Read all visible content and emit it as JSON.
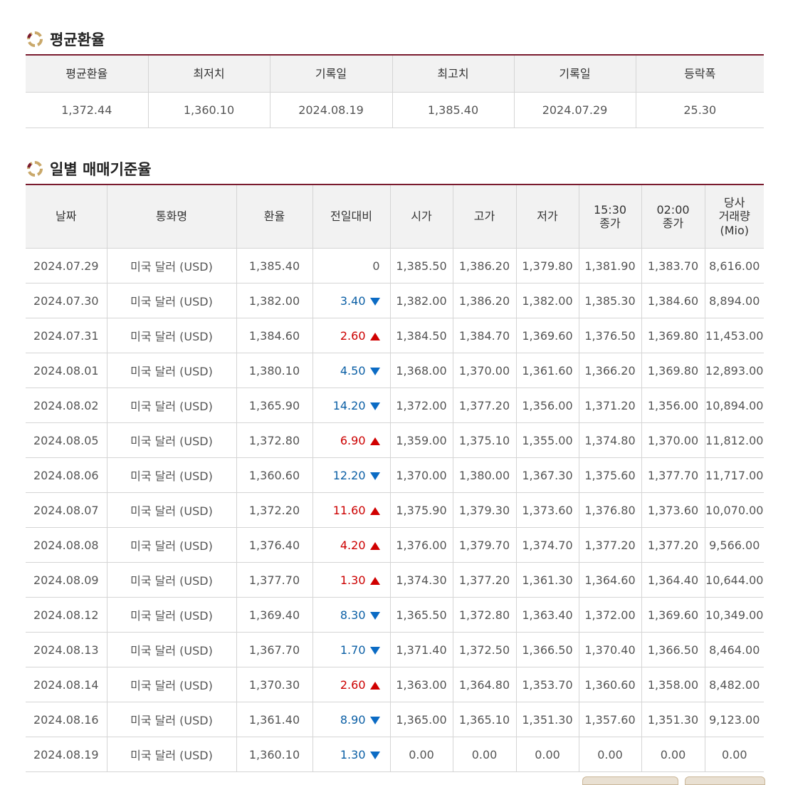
{
  "average_section": {
    "title": "평균환율",
    "headers": [
      "평균환율",
      "최저치",
      "기록일",
      "최고치",
      "기록일",
      "등락폭"
    ],
    "values": [
      "1,372.44",
      "1,360.10",
      "2024.08.19",
      "1,385.40",
      "2024.07.29",
      "25.30"
    ]
  },
  "daily_section": {
    "title": "일별 매매기준율",
    "headers": [
      "날짜",
      "통화명",
      "환율",
      "전일대비",
      "시가",
      "고가",
      "저가",
      "15:30\n종가",
      "02:00\n종가",
      "당사\n거래량\n(Mio)"
    ],
    "rows": [
      {
        "date": "2024.07.29",
        "currency": "미국 달러 (USD)",
        "rate": "1,385.40",
        "change": "0",
        "dir": "none",
        "open": "1,385.50",
        "high": "1,386.20",
        "low": "1,379.80",
        "close1530": "1,381.90",
        "close0200": "1,383.70",
        "volume": "8,616.00"
      },
      {
        "date": "2024.07.30",
        "currency": "미국 달러 (USD)",
        "rate": "1,382.00",
        "change": "3.40",
        "dir": "down",
        "open": "1,382.00",
        "high": "1,386.20",
        "low": "1,382.00",
        "close1530": "1,385.30",
        "close0200": "1,384.60",
        "volume": "8,894.00"
      },
      {
        "date": "2024.07.31",
        "currency": "미국 달러 (USD)",
        "rate": "1,384.60",
        "change": "2.60",
        "dir": "up",
        "open": "1,384.50",
        "high": "1,384.70",
        "low": "1,369.60",
        "close1530": "1,376.50",
        "close0200": "1,369.80",
        "volume": "11,453.00"
      },
      {
        "date": "2024.08.01",
        "currency": "미국 달러 (USD)",
        "rate": "1,380.10",
        "change": "4.50",
        "dir": "down",
        "open": "1,368.00",
        "high": "1,370.00",
        "low": "1,361.60",
        "close1530": "1,366.20",
        "close0200": "1,369.80",
        "volume": "12,893.00"
      },
      {
        "date": "2024.08.02",
        "currency": "미국 달러 (USD)",
        "rate": "1,365.90",
        "change": "14.20",
        "dir": "down",
        "open": "1,372.00",
        "high": "1,377.20",
        "low": "1,356.00",
        "close1530": "1,371.20",
        "close0200": "1,356.00",
        "volume": "10,894.00"
      },
      {
        "date": "2024.08.05",
        "currency": "미국 달러 (USD)",
        "rate": "1,372.80",
        "change": "6.90",
        "dir": "up",
        "open": "1,359.00",
        "high": "1,375.10",
        "low": "1,355.00",
        "close1530": "1,374.80",
        "close0200": "1,370.00",
        "volume": "11,812.00"
      },
      {
        "date": "2024.08.06",
        "currency": "미국 달러 (USD)",
        "rate": "1,360.60",
        "change": "12.20",
        "dir": "down",
        "open": "1,370.00",
        "high": "1,380.00",
        "low": "1,367.30",
        "close1530": "1,375.60",
        "close0200": "1,377.70",
        "volume": "11,717.00"
      },
      {
        "date": "2024.08.07",
        "currency": "미국 달러 (USD)",
        "rate": "1,372.20",
        "change": "11.60",
        "dir": "up",
        "open": "1,375.90",
        "high": "1,379.30",
        "low": "1,373.60",
        "close1530": "1,376.80",
        "close0200": "1,373.60",
        "volume": "10,070.00"
      },
      {
        "date": "2024.08.08",
        "currency": "미국 달러 (USD)",
        "rate": "1,376.40",
        "change": "4.20",
        "dir": "up",
        "open": "1,376.00",
        "high": "1,379.70",
        "low": "1,374.70",
        "close1530": "1,377.20",
        "close0200": "1,377.20",
        "volume": "9,566.00"
      },
      {
        "date": "2024.08.09",
        "currency": "미국 달러 (USD)",
        "rate": "1,377.70",
        "change": "1.30",
        "dir": "up",
        "open": "1,374.30",
        "high": "1,377.20",
        "low": "1,361.30",
        "close1530": "1,364.60",
        "close0200": "1,364.40",
        "volume": "10,644.00"
      },
      {
        "date": "2024.08.12",
        "currency": "미국 달러 (USD)",
        "rate": "1,369.40",
        "change": "8.30",
        "dir": "down",
        "open": "1,365.50",
        "high": "1,372.80",
        "low": "1,363.40",
        "close1530": "1,372.00",
        "close0200": "1,369.60",
        "volume": "10,349.00"
      },
      {
        "date": "2024.08.13",
        "currency": "미국 달러 (USD)",
        "rate": "1,367.70",
        "change": "1.70",
        "dir": "down",
        "open": "1,371.40",
        "high": "1,372.50",
        "low": "1,366.50",
        "close1530": "1,370.40",
        "close0200": "1,366.50",
        "volume": "8,464.00"
      },
      {
        "date": "2024.08.14",
        "currency": "미국 달러 (USD)",
        "rate": "1,370.30",
        "change": "2.60",
        "dir": "up",
        "open": "1,363.00",
        "high": "1,364.80",
        "low": "1,353.70",
        "close1530": "1,360.60",
        "close0200": "1,358.00",
        "volume": "8,482.00"
      },
      {
        "date": "2024.08.16",
        "currency": "미국 달러 (USD)",
        "rate": "1,361.40",
        "change": "8.90",
        "dir": "down",
        "open": "1,365.00",
        "high": "1,365.10",
        "low": "1,351.30",
        "close1530": "1,357.60",
        "close0200": "1,351.30",
        "volume": "9,123.00"
      },
      {
        "date": "2024.08.19",
        "currency": "미국 달러 (USD)",
        "rate": "1,360.10",
        "change": "1.30",
        "dir": "down",
        "open": "0.00",
        "high": "0.00",
        "low": "0.00",
        "close1530": "0.00",
        "close0200": "0.00",
        "volume": "0.00"
      }
    ]
  },
  "colors": {
    "accent": "#7a1b2e",
    "up": "#cc0000",
    "down": "#0b5fa5",
    "header_bg": "#f2f2f2"
  },
  "icons": {
    "section_icon": "ring-bullet-icon",
    "up_icon": "triangle-up-icon",
    "down_icon": "triangle-down-icon"
  }
}
